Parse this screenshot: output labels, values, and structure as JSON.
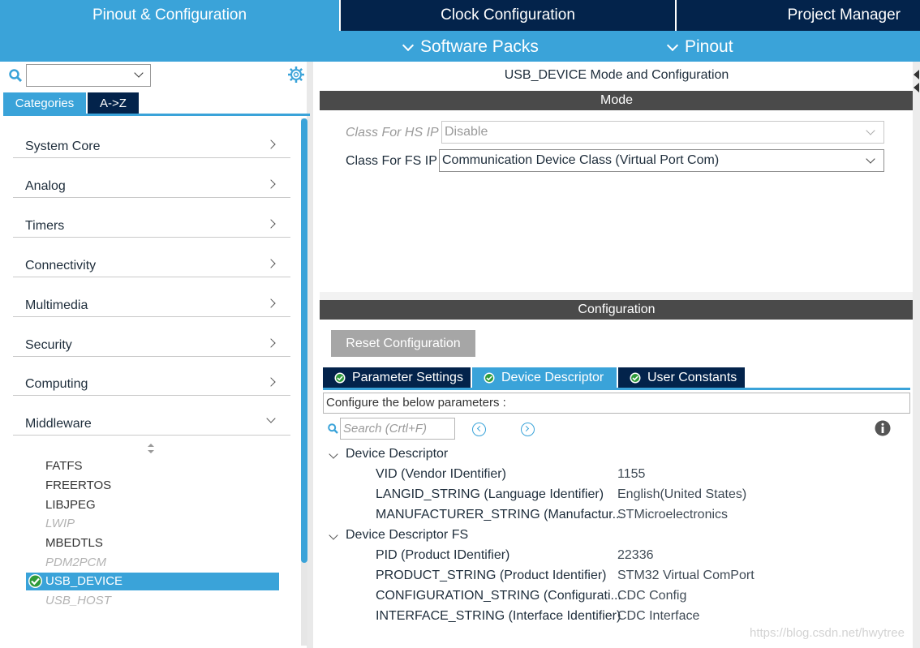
{
  "top_tabs": {
    "pinout_config": "Pinout & Configuration",
    "clock_config": "Clock Configuration",
    "project_manager": "Project Manager"
  },
  "sub_tabs": {
    "software_packs": "Software Packs",
    "pinout": "Pinout"
  },
  "left": {
    "search_value": "",
    "tabs": {
      "categories": "Categories",
      "az": "A->Z"
    },
    "categories": [
      "System Core",
      "Analog",
      "Timers",
      "Connectivity",
      "Multimedia",
      "Security",
      "Computing",
      "Middleware"
    ],
    "middleware_items": [
      {
        "label": "FATFS",
        "state": "normal"
      },
      {
        "label": "FREERTOS",
        "state": "normal"
      },
      {
        "label": "LIBJPEG",
        "state": "normal"
      },
      {
        "label": "LWIP",
        "state": "disabled"
      },
      {
        "label": "MBEDTLS",
        "state": "normal"
      },
      {
        "label": "PDM2PCM",
        "state": "disabled"
      },
      {
        "label": "USB_DEVICE",
        "state": "selected"
      },
      {
        "label": "USB_HOST",
        "state": "disabled"
      }
    ]
  },
  "mode": {
    "title": "USB_DEVICE Mode and Configuration",
    "section": "Mode",
    "hs_label": "Class For HS IP",
    "hs_value": "Disable",
    "fs_label": "Class For FS IP",
    "fs_value": "Communication Device Class (Virtual Port Com)"
  },
  "configuration": {
    "section": "Configuration",
    "reset_button": "Reset Configuration",
    "tabs": {
      "parameter_settings": "Parameter Settings",
      "device_descriptor": "Device Descriptor",
      "user_constants": "User Constants"
    },
    "hint": "Configure the below parameters :",
    "search_placeholder": "Search (Crtl+F)",
    "groups": [
      {
        "name": "Device Descriptor",
        "params": [
          {
            "name": "VID (Vendor IDentifier)",
            "value": "1155"
          },
          {
            "name": "LANGID_STRING (Language Identifier)",
            "value": "English(United States)"
          },
          {
            "name": "MANUFACTURER_STRING (Manufactur...",
            "value": "STMicroelectronics"
          }
        ]
      },
      {
        "name": "Device Descriptor FS",
        "params": [
          {
            "name": "PID (Product IDentifier)",
            "value": "22336"
          },
          {
            "name": "PRODUCT_STRING (Product Identifier)",
            "value": "STM32 Virtual ComPort"
          },
          {
            "name": "CONFIGURATION_STRING (Configurati...",
            "value": "CDC Config"
          },
          {
            "name": "INTERFACE_STRING (Interface Identifier)",
            "value": "CDC Interface"
          }
        ]
      }
    ]
  },
  "watermark": "https://blog.csdn.net/hwytree",
  "colors": {
    "accent": "#3aa3d9",
    "dark_navy": "#03234b",
    "section_bar": "#4a4a4a",
    "ok_green": "#2f9b3a"
  }
}
